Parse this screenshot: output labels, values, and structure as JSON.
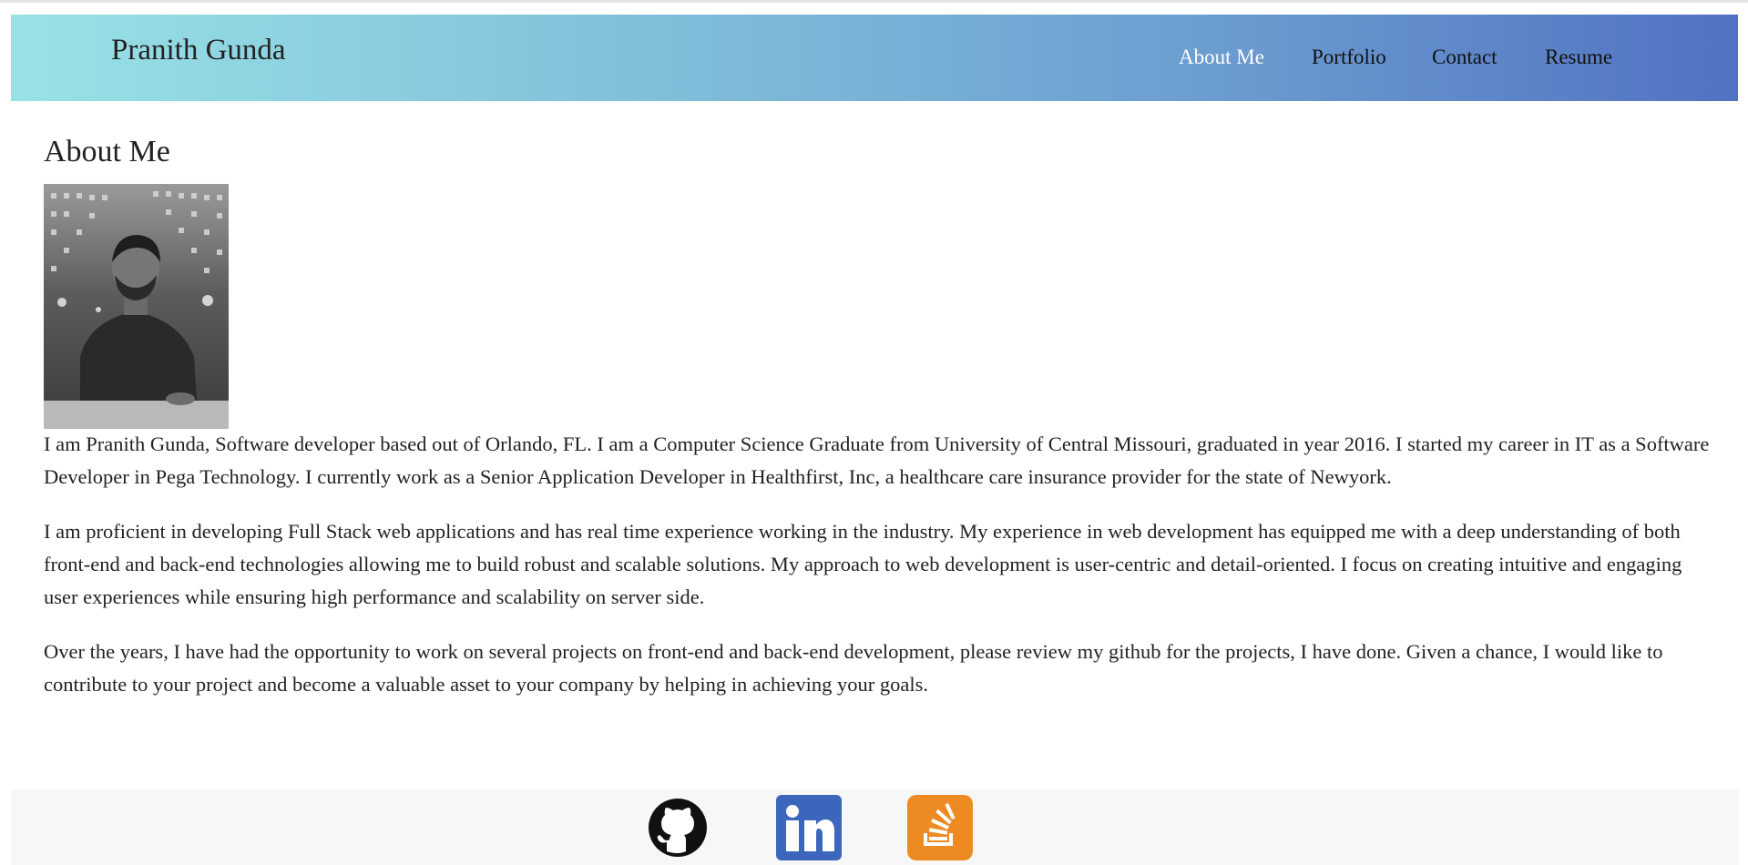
{
  "header": {
    "brand": "Pranith Gunda",
    "nav": [
      {
        "label": "About Me",
        "active": true
      },
      {
        "label": "Portfolio",
        "active": false
      },
      {
        "label": "Contact",
        "active": false
      },
      {
        "label": "Resume",
        "active": false
      }
    ],
    "gradient_colors": [
      "#98e2e6",
      "#5172c2"
    ]
  },
  "main": {
    "title": "About Me",
    "photo_icon": "profile-photo",
    "paragraphs": [
      "I am Pranith Gunda, Software developer based out of Orlando, FL. I am a Computer Science Graduate from University of Central Missouri, graduated in year 2016. I started my career in IT as a Software Developer in Pega Technology. I currently work as a Senior Application Developer in Healthfirst, Inc, a healthcare care insurance provider for the state of Newyork.",
      "I am proficient in developing Full Stack web applications and has real time experience working in the industry. My experience in web development has equipped me with a deep understanding of both front-end and back-end technologies allowing me to build robust and scalable solutions. My approach to web development is user-centric and detail-oriented. I focus on creating intuitive and engaging user experiences while ensuring high performance and scalability on server side.",
      "Over the years, I have had the opportunity to work on several projects on front-end and back-end development, please review my github for the projects, I have done. Given a chance, I would like to contribute to your project and become a valuable asset to your company by helping in achieving your goals."
    ]
  },
  "footer": {
    "social": [
      {
        "icon": "github-icon",
        "color": "#111111"
      },
      {
        "icon": "linkedin-icon",
        "color": "#3b66bc"
      },
      {
        "icon": "stackoverflow-icon",
        "color": "#ed8a22"
      }
    ]
  }
}
